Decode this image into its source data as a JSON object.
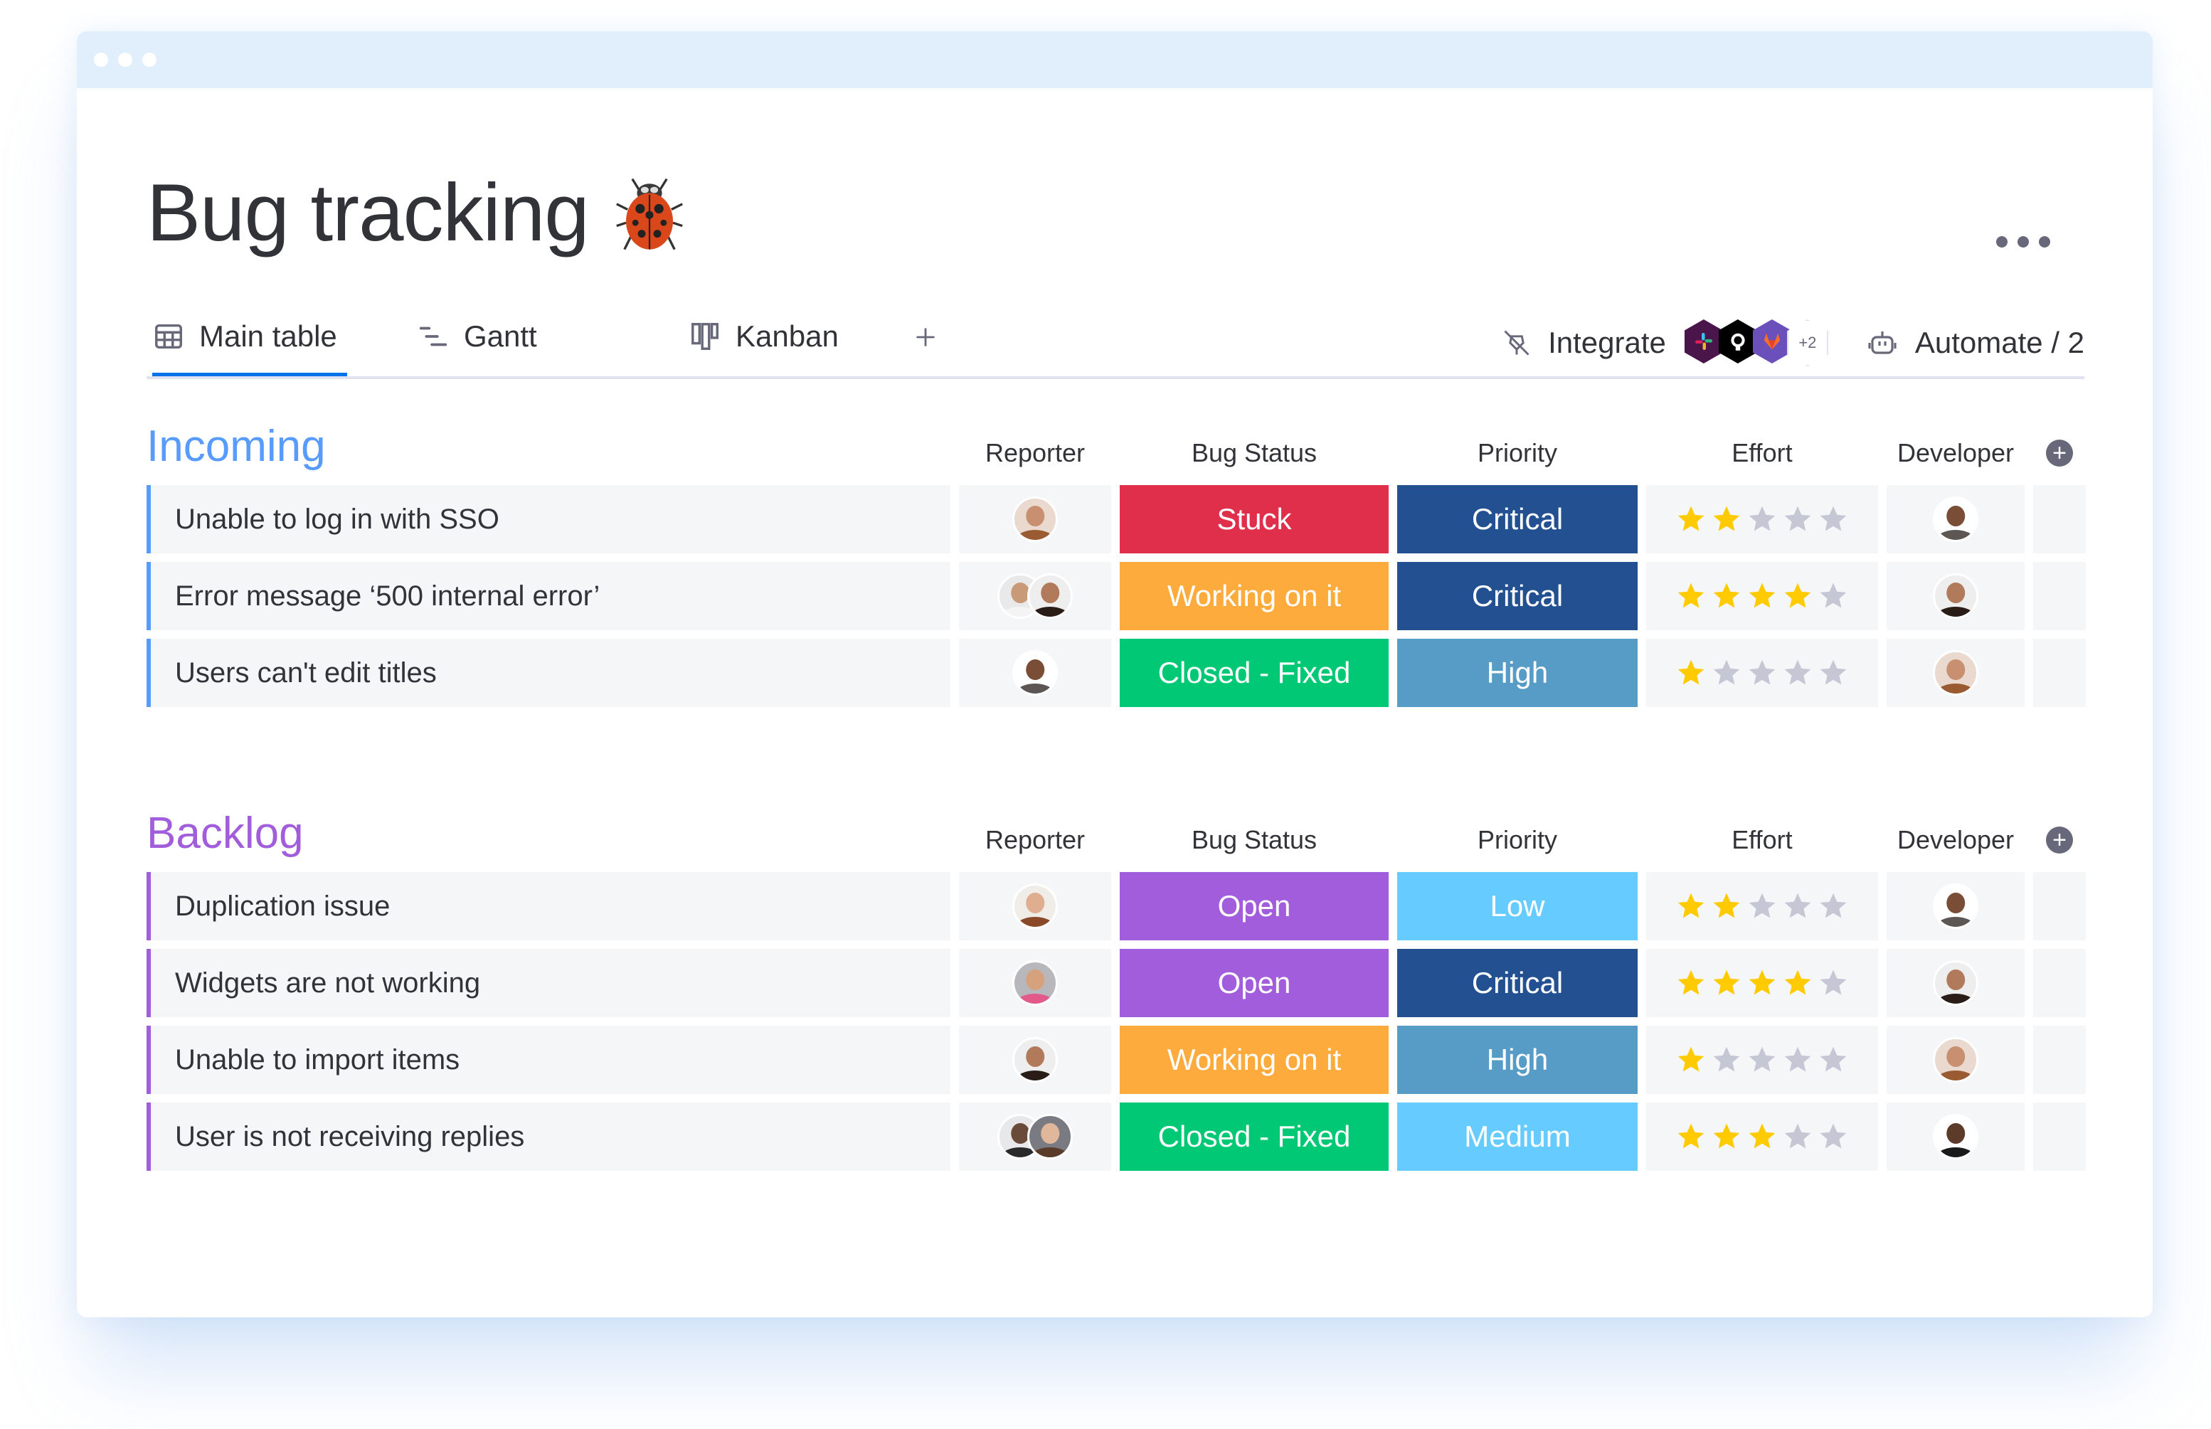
{
  "board": {
    "title": "Bug tracking",
    "title_icon": "ladybug-icon"
  },
  "views": {
    "tabs": [
      {
        "label": "Main table",
        "icon": "table-icon",
        "active": true
      },
      {
        "label": "Gantt",
        "icon": "gantt-icon",
        "active": false
      },
      {
        "label": "Kanban",
        "icon": "kanban-icon",
        "active": false
      }
    ],
    "add_view_label": "+"
  },
  "toolbar": {
    "integrate_label": "Integrate",
    "integrations": [
      "slack",
      "github",
      "gitlab"
    ],
    "integrations_more": "+2",
    "automate_label": "Automate / 2"
  },
  "columns": {
    "reporter": "Reporter",
    "status": "Bug Status",
    "priority": "Priority",
    "effort": "Effort",
    "developer": "Developer"
  },
  "colors": {
    "accent": "#0073ea",
    "incoming": "#579bfc",
    "backlog": "#a25ddc",
    "status": {
      "Stuck": "#df2f4a",
      "Working on it": "#fdab3d",
      "Closed - Fixed": "#00c875",
      "Open": "#a25ddc"
    },
    "priority": {
      "Critical": "#225091",
      "High": "#579bc7",
      "Medium": "#66ccff",
      "Low": "#66ccff"
    },
    "star_on": "#ffcb00",
    "star_off": "#c5c7d4"
  },
  "groups": [
    {
      "title": "Incoming",
      "items": [
        {
          "name": "Unable to log in with SSO",
          "reporters": [
            "woman-curly-hair"
          ],
          "status": "Stuck",
          "priority": "Critical",
          "effort": 2,
          "developer": "man-glasses"
        },
        {
          "name": "Error message ‘500 internal error’",
          "reporters": [
            "man-short-hair",
            "woman-long-hair"
          ],
          "status": "Working on it",
          "priority": "Critical",
          "effort": 4,
          "developer": "woman-long-hair"
        },
        {
          "name": "Users can't edit titles",
          "reporters": [
            "man-glasses"
          ],
          "status": "Closed - Fixed",
          "priority": "High",
          "effort": 1,
          "developer": "woman-curly-hair"
        }
      ]
    },
    {
      "title": "Backlog",
      "items": [
        {
          "name": "Duplication issue",
          "reporters": [
            "woman-auburn-hair"
          ],
          "status": "Open",
          "priority": "Low",
          "effort": 2,
          "developer": "man-glasses"
        },
        {
          "name": "Widgets are not working",
          "reporters": [
            "man-beard"
          ],
          "status": "Open",
          "priority": "Critical",
          "effort": 4,
          "developer": "woman-long-hair"
        },
        {
          "name": "Unable to import items",
          "reporters": [
            "woman-long-hair"
          ],
          "status": "Working on it",
          "priority": "High",
          "effort": 1,
          "developer": "woman-curly-hair"
        },
        {
          "name": "User is not receiving replies",
          "reporters": [
            "man-cap",
            "woman-brown-hair"
          ],
          "status": "Closed - Fixed",
          "priority": "Medium",
          "effort": 3,
          "developer": "man-bald"
        }
      ]
    }
  ]
}
